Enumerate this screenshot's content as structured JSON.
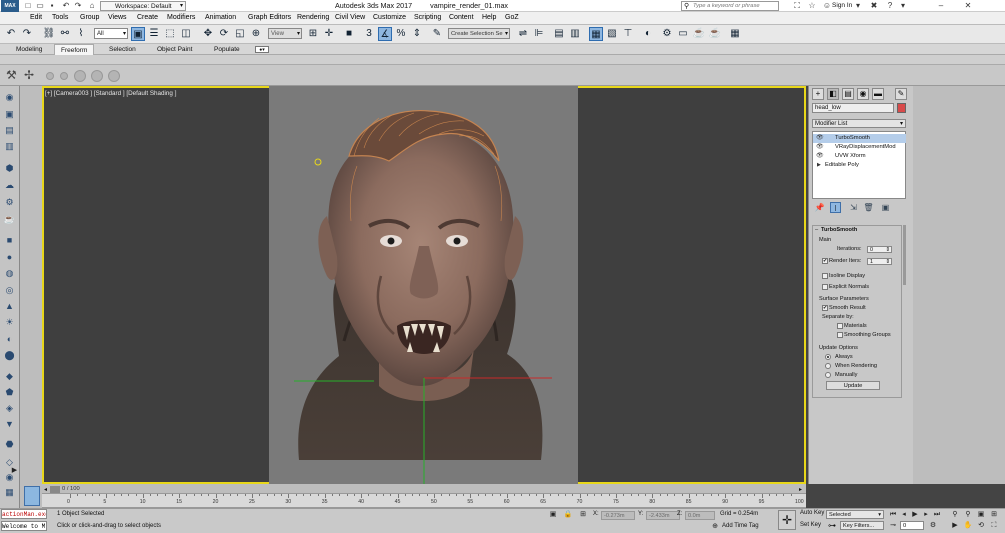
{
  "titlebar": {
    "logo": "MAX",
    "workspace_label": "Workspace: Default",
    "title": "Autodesk 3ds Max 2017",
    "file": "vampire_render_01.max",
    "search_placeholder": "Type a keyword or phrase",
    "signin": "Sign In"
  },
  "menu": [
    "Edit",
    "Tools",
    "Group",
    "Views",
    "Create",
    "Modifiers",
    "Animation",
    "Graph Editors",
    "Rendering",
    "Civil View",
    "Customize",
    "Scripting",
    "Content",
    "Help",
    "GoZ"
  ],
  "toolbar": {
    "selection_filter": "All",
    "ref_coord": "View",
    "named_selection": "Create Selection Se"
  },
  "ribbon_tabs": [
    "Modeling",
    "Freeform",
    "Selection",
    "Object Paint",
    "Populate"
  ],
  "ribbon_selected": "Freeform",
  "viewport": {
    "label": "[+] [Camera003 ] [Standard ] [Default Shading ]"
  },
  "command_panel": {
    "object_name": "head_low",
    "object_color": "#d84b4b",
    "modifier_list_label": "Modifier List",
    "stack": [
      {
        "name": "TurboSmooth",
        "selected": true
      },
      {
        "name": "VRayDisplacementMod",
        "selected": false
      },
      {
        "name": "UVW Xform",
        "selected": false
      },
      {
        "name": "Editable Poly",
        "selected": false
      }
    ],
    "rollout": {
      "title": "TurboSmooth",
      "main": "Main",
      "iterations_label": "Iterations:",
      "iterations_value": "0",
      "render_iters_label": "Render Iters:",
      "render_iters_value": "1",
      "render_iters_checked": true,
      "isoline": "Isoline Display",
      "explicit": "Explicit Normals",
      "surface_params": "Surface Parameters",
      "smooth_result": "Smooth Result",
      "separate_by": "Separate by:",
      "materials": "Materials",
      "smoothing_groups": "Smoothing Groups",
      "update_options": "Update Options",
      "always": "Always",
      "when_rendering": "When Rendering",
      "manually": "Manually",
      "update_button": "Update"
    }
  },
  "timeline": {
    "frame_label": "0 / 100",
    "ticks": [
      "0",
      "5",
      "10",
      "15",
      "20",
      "25",
      "30",
      "35",
      "40",
      "45",
      "50",
      "55",
      "60",
      "65",
      "70",
      "75",
      "80",
      "85",
      "90",
      "95",
      "100"
    ]
  },
  "status": {
    "maxscript_line1": "actionMan.exe",
    "maxscript_line2": "Welcome to M",
    "selected": "1 Object Selected",
    "prompt": "Click or click-and-drag to select objects",
    "x_label": "X:",
    "x_value": "-0.273m",
    "y_label": "Y:",
    "y_value": "-2.433m",
    "z_label": "Z:",
    "z_value": "0.0m",
    "grid": "Grid = 0.254m",
    "add_time_tag": "Add Time Tag",
    "auto_key": "Auto Key",
    "set_key": "Set Key",
    "selected_dropdown": "Selected",
    "key_filters": "Key Filters...",
    "frame_field": "0"
  }
}
